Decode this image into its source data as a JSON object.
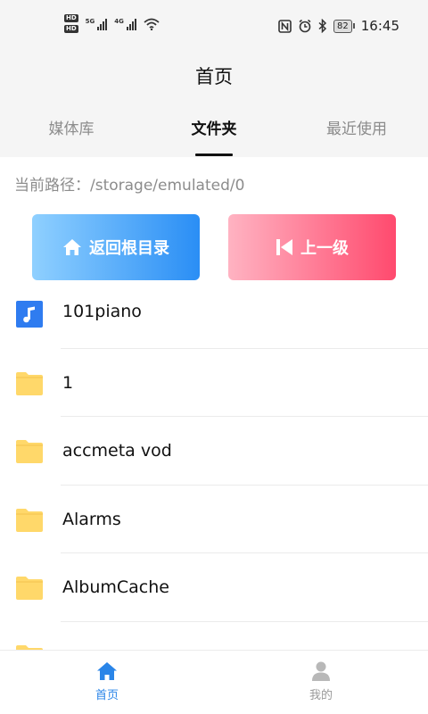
{
  "status_bar": {
    "hd_badge": "HD",
    "signal_1_label": "5G",
    "signal_2_label": "4G",
    "battery_level": "82",
    "time": "16:45"
  },
  "header": {
    "title": "首页"
  },
  "tabs": [
    {
      "label": "媒体库",
      "active": false
    },
    {
      "label": "文件夹",
      "active": true
    },
    {
      "label": "最近使用",
      "active": false
    }
  ],
  "path": {
    "label": "当前路径：/storage/emulated/0"
  },
  "actions": {
    "root_label": "返回根目录",
    "up_label": "上一级"
  },
  "files": [
    {
      "name": "101piano",
      "icon": "music-file-icon"
    },
    {
      "name": "1",
      "icon": "folder-icon"
    },
    {
      "name": "accmeta vod",
      "icon": "folder-icon"
    },
    {
      "name": "Alarms",
      "icon": "folder-icon"
    },
    {
      "name": "AlbumCache",
      "icon": "folder-icon"
    }
  ],
  "bottom_nav": [
    {
      "label": "首页",
      "icon": "home-icon",
      "active": true
    },
    {
      "label": "我的",
      "icon": "user-icon",
      "active": false
    }
  ],
  "colors": {
    "accent": "#2a85e8",
    "folder": "#ffd86a",
    "music_icon": "#2f7cf0",
    "up_button_start": "#ffb3c2",
    "up_button_end": "#ff4a6e",
    "root_button_start": "#8fd0ff",
    "root_button_end": "#2a8ef5"
  }
}
